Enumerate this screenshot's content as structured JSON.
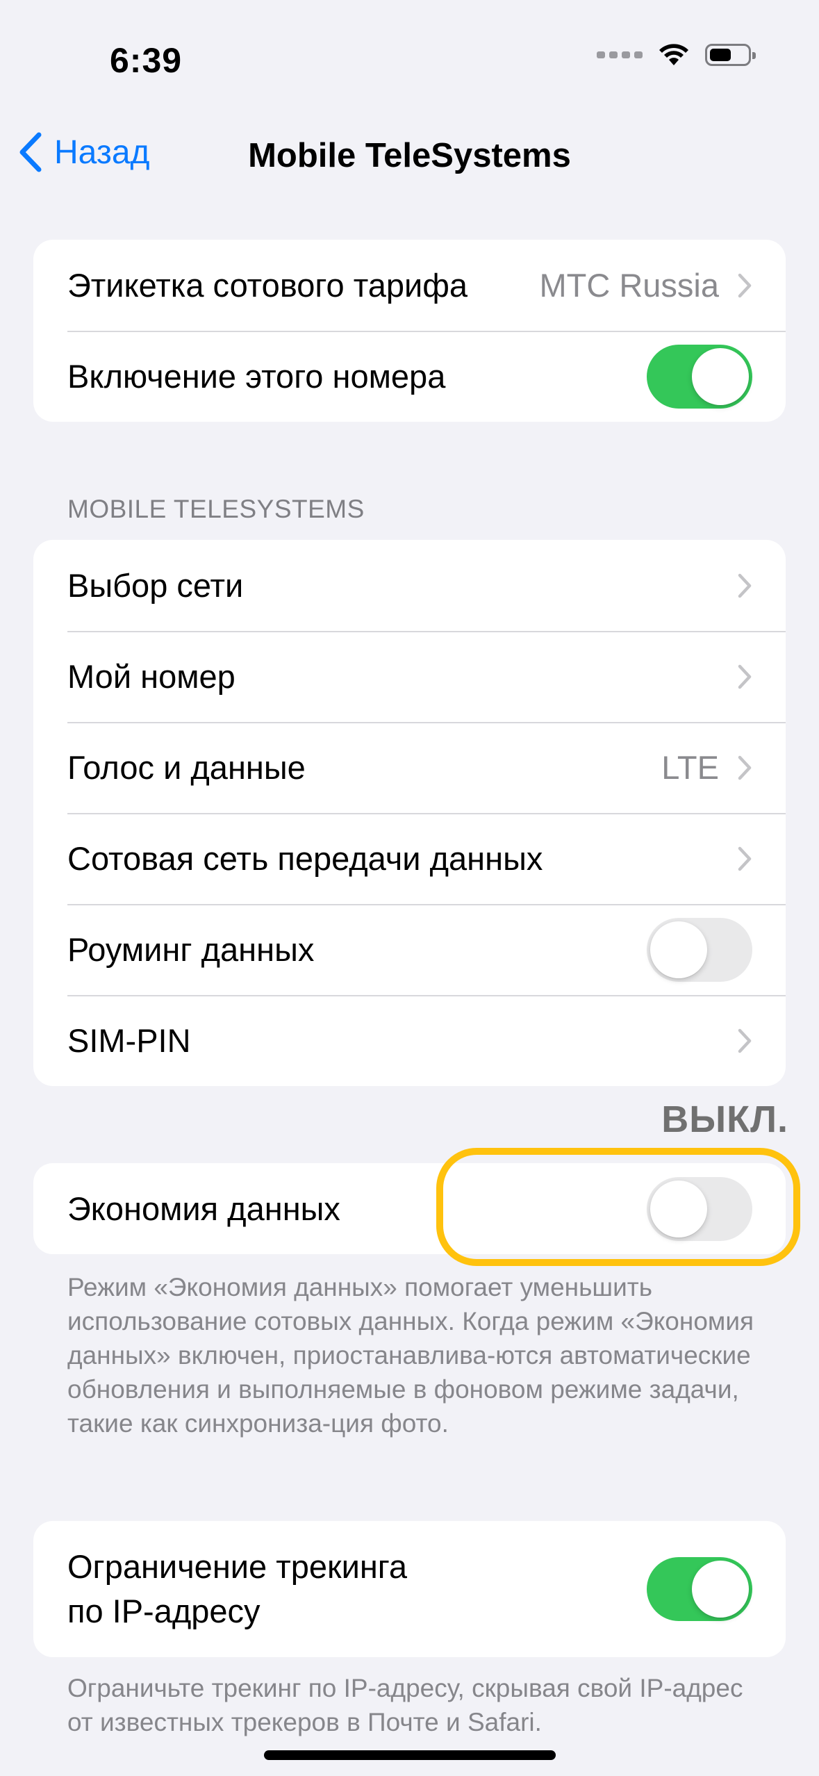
{
  "status_bar": {
    "time": "6:39"
  },
  "nav": {
    "back_label": "Назад",
    "title": "Mobile TeleSystems"
  },
  "group1": {
    "rows": [
      {
        "label": "Этикетка сотового тарифа",
        "value": "MTC Russia"
      },
      {
        "label": "Включение этого номера",
        "toggle": "on"
      }
    ]
  },
  "section_header": "MOBILE TELESYSTEMS",
  "group2": {
    "rows": [
      {
        "label": "Выбор сети"
      },
      {
        "label": "Мой номер"
      },
      {
        "label": "Голос и данные",
        "value": "LTE"
      },
      {
        "label": "Сотовая сеть передачи данных"
      },
      {
        "label": "Роуминг данных",
        "toggle": "off"
      },
      {
        "label": "SIM-PIN"
      }
    ]
  },
  "annotation": {
    "off_caption": "ВЫКЛ."
  },
  "group3": {
    "label": "Экономия данных",
    "toggle": "off",
    "footer": "Режим «Экономия данных» помогает уменьшить использование сотовых данных. Когда режим «Экономия данных» включен, приостанавлива-ются автоматические обновления и выполняемые в фоновом режиме задачи, такие как синхрониза-ция фото."
  },
  "group4": {
    "label_line1": "Ограничение трекинга",
    "label_line2": "по IP-адресу",
    "toggle": "on",
    "footer": "Ограничьте трекинг по IP-адресу, скрывая свой IP-адрес от известных трекеров в Почте и Safari."
  },
  "colors": {
    "accent": "#0a7aff",
    "toggle_on": "#34c759",
    "highlight": "#ffc20e",
    "background": "#f2f2f7"
  }
}
